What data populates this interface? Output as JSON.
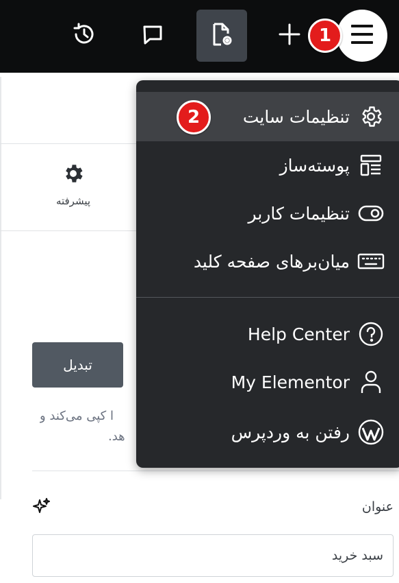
{
  "topbar": {
    "history_icon": "history-icon",
    "comments_icon": "comment-icon",
    "page_settings_icon": "page-settings-icon",
    "add_icon": "plus-icon",
    "menu_icon": "hamburger-menu-icon"
  },
  "markers": [
    "1",
    "2"
  ],
  "panel": {
    "advanced_tab": "پیشرفته",
    "convert_button": "تبدیل",
    "description_line1": "ا کپی می‌کند و",
    "description_line2": "هد.",
    "title_label": "عنوان",
    "title_value": "سبد خرید",
    "ai_icon": "sparkle-icon"
  },
  "menu": {
    "items": [
      {
        "label": "تنظیمات سایت",
        "icon": "gear-icon"
      },
      {
        "label": "پوسته‌ساز",
        "icon": "theme-builder-icon"
      },
      {
        "label": "تنظیمات کاربر",
        "icon": "toggle-icon"
      },
      {
        "label": "میان‌برهای صفحه کلید",
        "icon": "keyboard-icon"
      },
      {
        "label": "Help Center",
        "icon": "help-circle-icon"
      },
      {
        "label": "My Elementor",
        "icon": "user-icon"
      },
      {
        "label": "رفتن به وردپرس",
        "icon": "wordpress-icon"
      }
    ]
  },
  "colors": {
    "topbar_bg": "#0c0d0e",
    "menu_bg": "#26282b",
    "menu_highlight": "#404246",
    "marker_red": "#e31c1c",
    "button_bg": "#515962"
  }
}
